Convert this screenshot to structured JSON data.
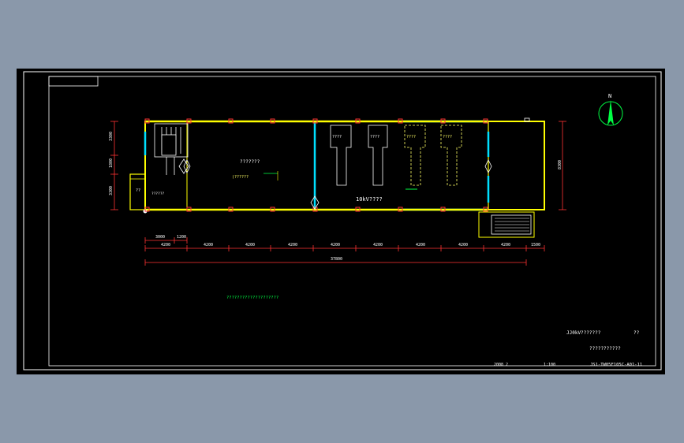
{
  "drawing": {
    "room_label": "???????",
    "room_sublabel": "(??????",
    "hall_label": "10kV????",
    "cabinet_label": "????",
    "stair_label": "??",
    "stair_code": "??????",
    "note_text": "????????????????????",
    "north_label": "N"
  },
  "dimensions": {
    "left_vertical": [
      "3300",
      "1800",
      "3300"
    ],
    "right_vertical": "8300",
    "top_chain": [
      "3000",
      "1200"
    ],
    "main_chain": [
      "4200",
      "4200",
      "4200",
      "4200",
      "4200",
      "4200",
      "4200",
      "4200",
      "4200",
      "1500"
    ],
    "total": "37800"
  },
  "title_block": {
    "line1": "JJ0kV???????",
    "line1_b": "??",
    "line2": "???????????",
    "date": "2008   2",
    "scale": "1:100",
    "drawing_no": "JS1-TW05F105C-A01-11"
  },
  "colors": {
    "wall": "#ffff00",
    "window": "#00e0ff",
    "column": "#ff3333",
    "dimension": "#ff3333",
    "text": "#ffffff",
    "equipment": "#ffff66",
    "note": "#00ff44"
  }
}
